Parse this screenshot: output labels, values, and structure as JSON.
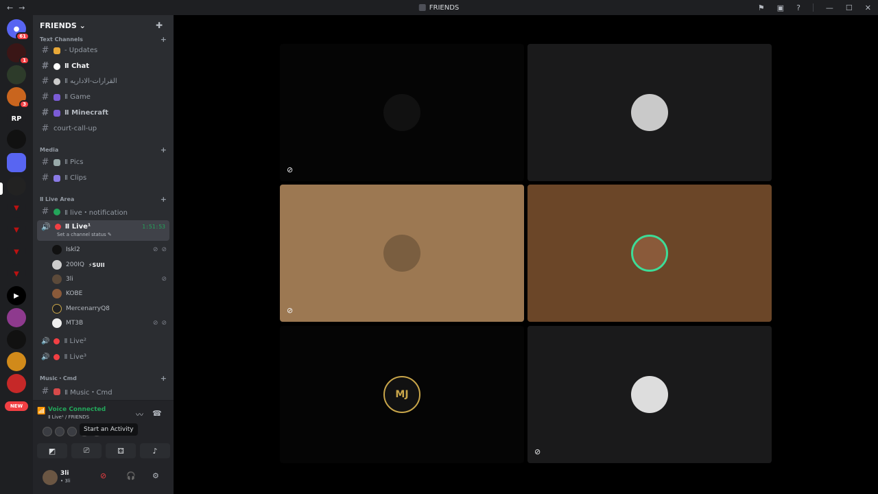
{
  "titlebar": {
    "title": "FRIENDS",
    "back": "←",
    "forward": "→"
  },
  "guild_badges": {
    "home": "61",
    "g1": "1",
    "g2": "3",
    "rp": "RP",
    "new": "NEW"
  },
  "server": {
    "name": "FRIENDS ⌄"
  },
  "categories": {
    "text": "Text Channels",
    "media": "Media",
    "live": "Ⅱ Live Area",
    "music": "Music・Cmd"
  },
  "text_channels": [
    {
      "name": "- Updates"
    },
    {
      "name": "Ⅱ Chat"
    },
    {
      "name": "Ⅱ القرارات-الاداريه"
    },
    {
      "name": "Ⅱ Game"
    },
    {
      "name": "Ⅱ Minecraft"
    },
    {
      "name": "court-call-up"
    }
  ],
  "media_channels": [
    {
      "name": "Ⅱ Pics"
    },
    {
      "name": "Ⅱ Clips"
    }
  ],
  "live_notification": "Ⅱ live・notification",
  "voice_active": {
    "name": "Ⅱ Live¹",
    "timer": "1:51:53",
    "status": "Set a channel status"
  },
  "members": [
    {
      "name": "Iskl2"
    },
    {
      "name": "200IQ",
      "tag": "⚡SUII"
    },
    {
      "name": "3li"
    },
    {
      "name": "KOBE"
    },
    {
      "name": "MercenarryQ8"
    },
    {
      "name": "MT3B"
    }
  ],
  "voice_channels": [
    {
      "name": "Ⅱ Live²"
    },
    {
      "name": "Ⅱ Live³"
    }
  ],
  "music_channel": "Ⅱ Music・Cmd",
  "voice_panel": {
    "status": "Voice Connected",
    "sub": "Ⅱ Live¹ / FRIENDS",
    "tooltip": "Start an Activity"
  },
  "user": {
    "name": "3li",
    "tag": "• 3li"
  },
  "tiles": [
    {
      "bg": "#050505"
    },
    {
      "bg": "#1a1a1b"
    },
    {
      "bg": "#9c7852"
    },
    {
      "bg": "#6b4628"
    },
    {
      "bg": "#050505",
      "label": "MJ"
    },
    {
      "bg": "#1a1a1b"
    }
  ]
}
